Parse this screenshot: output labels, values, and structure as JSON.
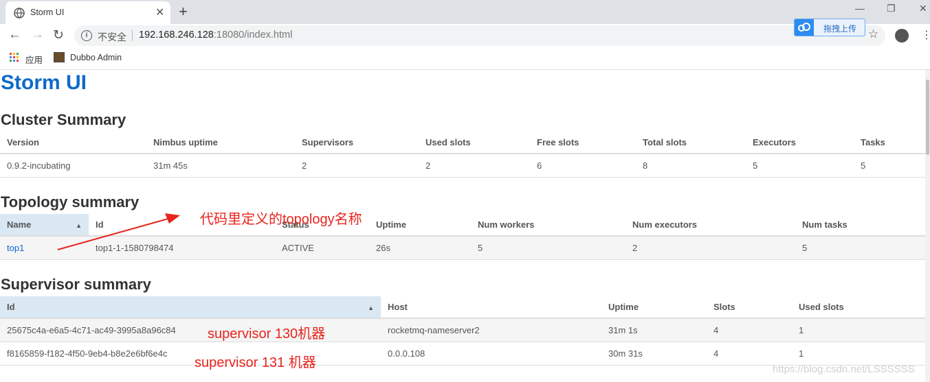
{
  "browser": {
    "tab_title": "Storm UI",
    "tab_close": "✕",
    "new_tab": "+",
    "insecure_label": "不安全",
    "url_host": "192.168.246.128",
    "url_rest": ":18080/index.html",
    "extension_label": "拖拽上传",
    "bookmarks": [
      {
        "label": "应用"
      },
      {
        "label": "Dubbo Admin"
      }
    ]
  },
  "page": {
    "brand": "Storm UI",
    "cluster": {
      "heading": "Cluster Summary",
      "columns": [
        "Version",
        "Nimbus uptime",
        "Supervisors",
        "Used slots",
        "Free slots",
        "Total slots",
        "Executors",
        "Tasks"
      ],
      "rows": [
        [
          "0.9.2-incubating",
          "31m 45s",
          "2",
          "2",
          "6",
          "8",
          "5",
          "5"
        ]
      ]
    },
    "topology": {
      "heading": "Topology summary",
      "columns": [
        "Name",
        "Id",
        "Status",
        "Uptime",
        "Num workers",
        "Num executors",
        "Num tasks"
      ],
      "rows": [
        [
          "top1",
          "top1-1-1580798474",
          "ACTIVE",
          "26s",
          "5",
          "2",
          "5"
        ]
      ]
    },
    "supervisor": {
      "heading": "Supervisor summary",
      "columns": [
        "Id",
        "Host",
        "Uptime",
        "Slots",
        "Used slots"
      ],
      "rows": [
        [
          "25675c4a-e6a5-4c71-ac49-3995a8a96c84",
          "rocketmq-nameserver2",
          "31m 1s",
          "4",
          "1"
        ],
        [
          "f8165859-f182-4f50-9eb4-b8e2e6bf6e4c",
          "0.0.0.108",
          "30m 31s",
          "4",
          "1"
        ]
      ]
    }
  },
  "annotations": {
    "topology_note": "代码里定义的topology名称",
    "sup130": "supervisor 130机器",
    "sup131": "supervisor 131 机器"
  },
  "watermark": "https://blog.csdn.net/LSSSSSS",
  "colors": {
    "brand": "#0f6ac9",
    "annotation": "#e8241d",
    "sorted_header": "#d9e8f3"
  }
}
